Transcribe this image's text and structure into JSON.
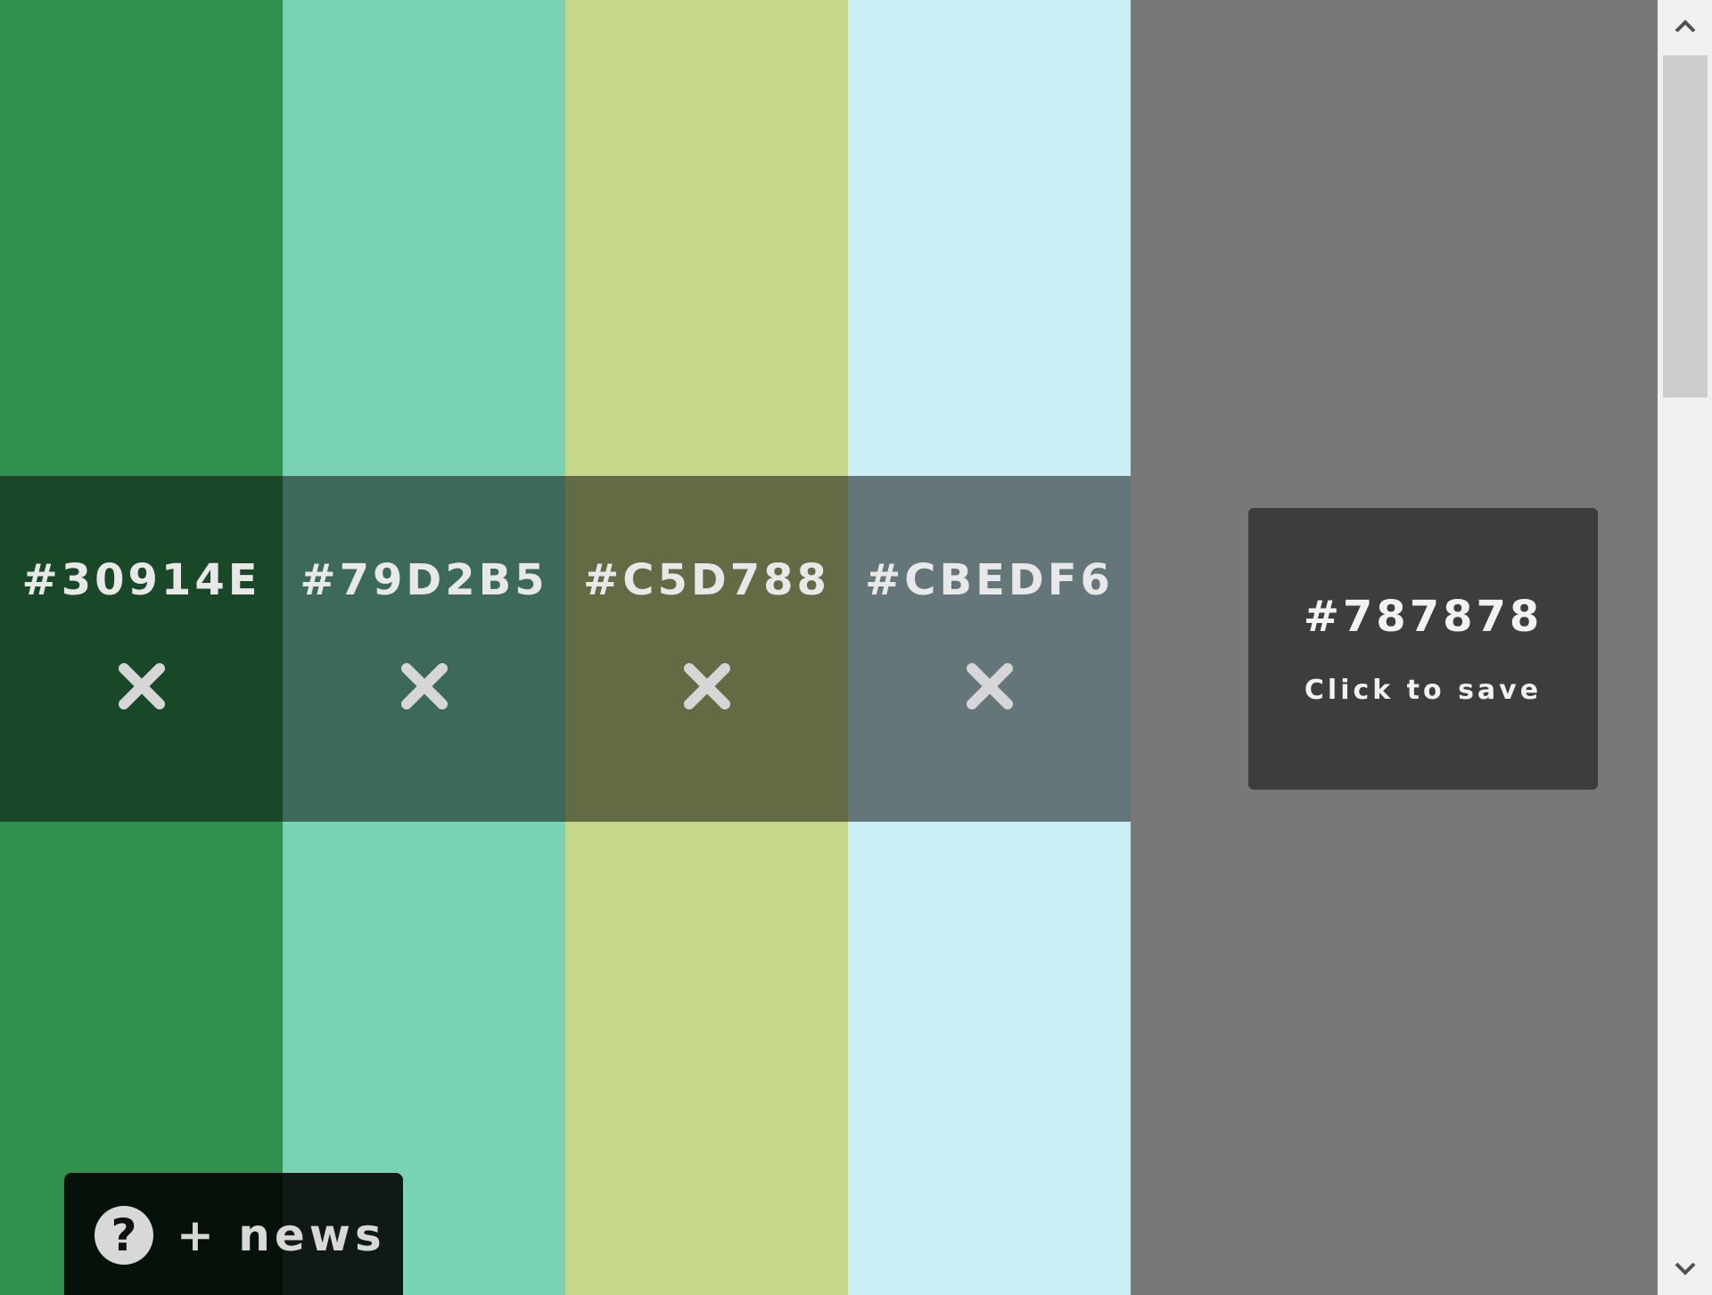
{
  "palette": {
    "swatches": [
      {
        "hex": "#30914E",
        "color": "#30914E",
        "remove_icon": "close-x-icon"
      },
      {
        "hex": "#79D2B5",
        "color": "#79D2B5",
        "remove_icon": "close-x-icon"
      },
      {
        "hex": "#C5D788",
        "color": "#C5D788",
        "remove_icon": "close-x-icon"
      },
      {
        "hex": "#CBEDF6",
        "color": "#CBEDF6",
        "remove_icon": "close-x-icon"
      }
    ]
  },
  "preview": {
    "color": "#787878",
    "hex": "#787878",
    "save_label": "Click to save"
  },
  "help": {
    "icon": "question-mark-icon",
    "label": "+ news"
  },
  "scrollbar": {
    "up_icon": "chevron-up-icon",
    "down_icon": "chevron-down-icon"
  }
}
